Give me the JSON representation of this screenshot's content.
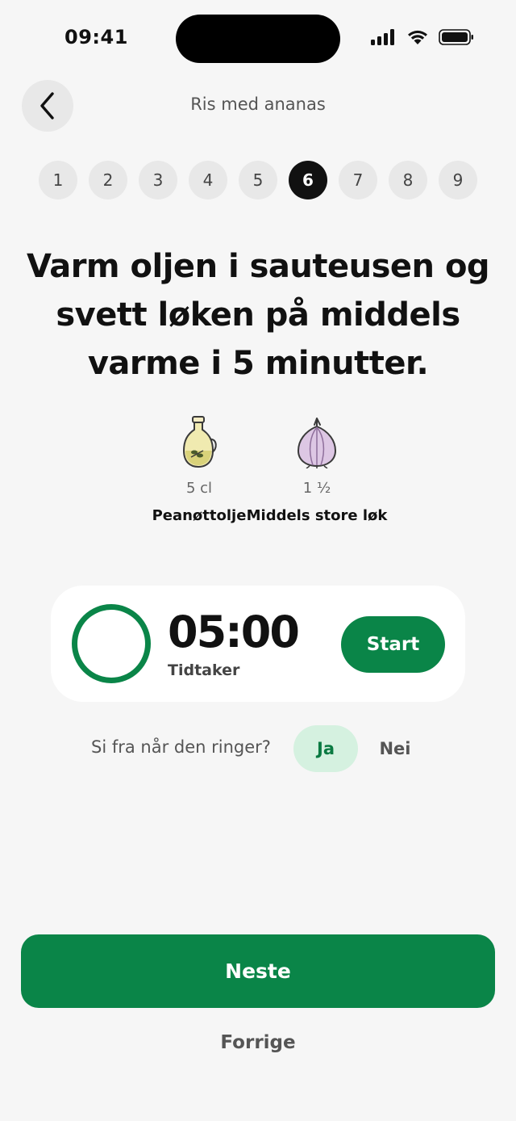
{
  "status_bar": {
    "time": "09:41"
  },
  "header": {
    "title": "Ris med ananas"
  },
  "steps": [
    "1",
    "2",
    "3",
    "4",
    "5",
    "6",
    "7",
    "8",
    "9"
  ],
  "active_step": "6",
  "instruction": "Varm oljen i sauteusen og svett løken på middels varme i 5 minutter.",
  "ingredients": [
    {
      "icon": "oil-bottle-icon",
      "amount": "5 cl",
      "name": "Peanøttolje"
    },
    {
      "icon": "onion-icon",
      "amount": "1 ½",
      "name": "Middels store løk"
    }
  ],
  "timer": {
    "value": "05:00",
    "label": "Tidtaker",
    "start_label": "Start"
  },
  "notify": {
    "question": "Si fra når den ringer?",
    "yes": "Ja",
    "no": "Nei"
  },
  "actions": {
    "next": "Neste",
    "previous": "Forrige"
  },
  "colors": {
    "accent": "#0a8548",
    "accent_light": "#d5f1e0",
    "background": "#f6f6f6"
  }
}
